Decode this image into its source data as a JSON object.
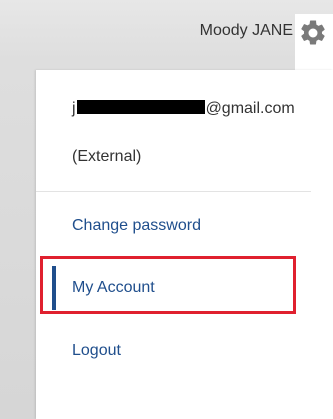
{
  "header": {
    "user_name": "Moody JANE",
    "settings_icon": "gear-icon"
  },
  "account_menu": {
    "email_prefix": "j",
    "email_suffix": "@gmail.com",
    "account_type": "(External)",
    "items": [
      {
        "label": "Change password"
      },
      {
        "label": "My Account",
        "active": true
      },
      {
        "label": "Logout"
      }
    ]
  },
  "colors": {
    "link": "#1f4e8c",
    "active_indicator": "#1f4e8c",
    "highlight_outline": "#e0202f",
    "text": "#333333"
  }
}
